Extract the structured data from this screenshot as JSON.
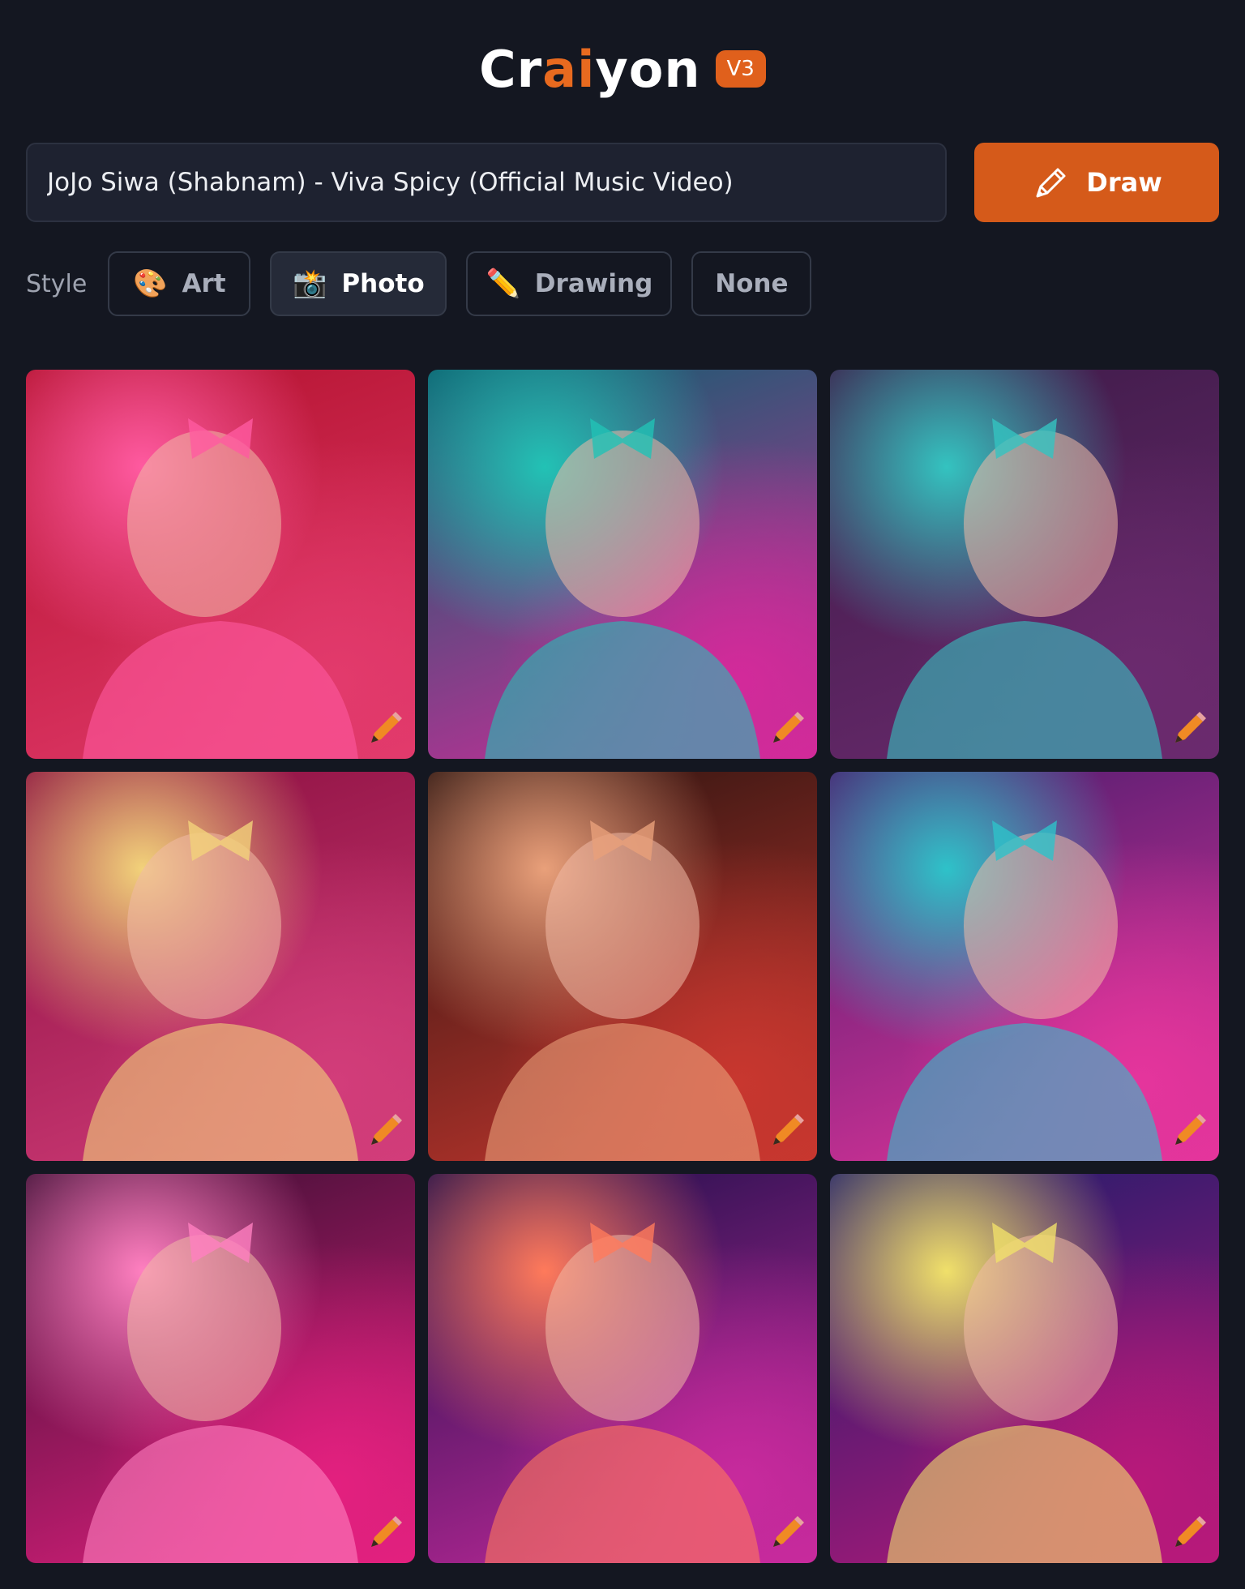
{
  "logo": {
    "pre": "Cr",
    "accent": "ai",
    "post": "yon",
    "version": "V3",
    "accent_color": "#e86a1f"
  },
  "prompt": {
    "value": "JoJo Siwa (Shabnam) - Viva Spicy (Official Music Video)"
  },
  "draw_button": {
    "label": "Draw",
    "icon": "pencil-icon",
    "color": "#d55a1a"
  },
  "style": {
    "label": "Style",
    "options": [
      {
        "label": "Art",
        "icon": "palette-icon",
        "emoji": "🎨",
        "selected": false
      },
      {
        "label": "Photo",
        "icon": "camera-flash-icon",
        "emoji": "📸",
        "selected": true
      },
      {
        "label": "Drawing",
        "icon": "pencil-icon",
        "emoji": "✏️",
        "selected": false
      },
      {
        "label": "None",
        "icon": "",
        "emoji": "",
        "selected": false
      }
    ]
  },
  "gallery": {
    "images": [
      {
        "id": 1,
        "palette": [
          "#b3122e",
          "#e23a6c",
          "#ff5aa0"
        ]
      },
      {
        "id": 2,
        "palette": [
          "#0c5f6e",
          "#d32a9a",
          "#22c2b5"
        ]
      },
      {
        "id": 3,
        "palette": [
          "#3d1b48",
          "#6b2a6e",
          "#34c3c0"
        ]
      },
      {
        "id": 4,
        "palette": [
          "#8a0f3f",
          "#d23d7a",
          "#f2d27a"
        ]
      },
      {
        "id": 5,
        "palette": [
          "#2a1410",
          "#c8372f",
          "#e9a07a"
        ]
      },
      {
        "id": 6,
        "palette": [
          "#4b1c6e",
          "#e5359c",
          "#2ec2c9"
        ]
      },
      {
        "id": 7,
        "palette": [
          "#3a0f33",
          "#e3207f",
          "#ff80c0"
        ]
      },
      {
        "id": 8,
        "palette": [
          "#1c0f4a",
          "#c82a9d",
          "#ff7a5b"
        ]
      },
      {
        "id": 9,
        "palette": [
          "#1c1c6b",
          "#b8197a",
          "#f0e06a"
        ]
      }
    ],
    "edit_icon": "pencil-icon"
  }
}
